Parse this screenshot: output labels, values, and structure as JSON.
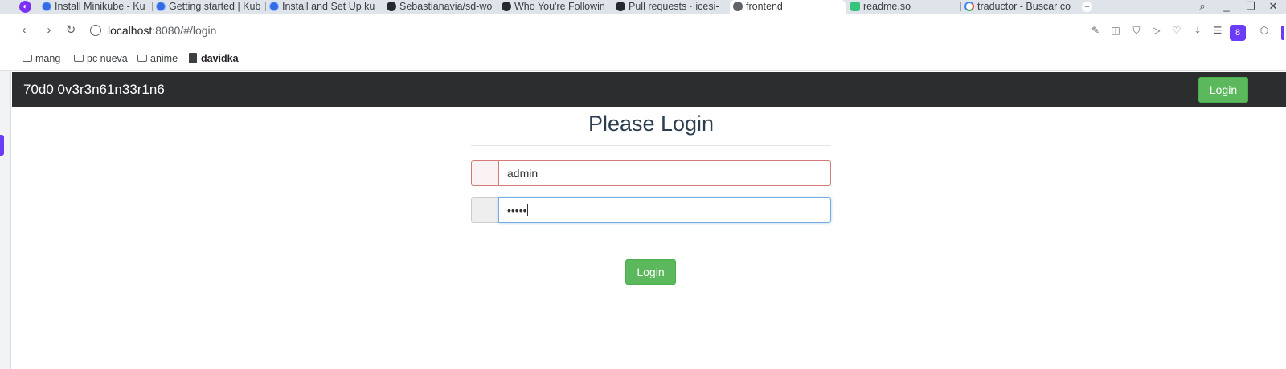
{
  "browser": {
    "tabs": [
      {
        "label": "Install Minikube - Ku",
        "favicon": "kubernetes-icon"
      },
      {
        "label": "Getting started | Kub",
        "favicon": "kubernetes-icon"
      },
      {
        "label": "Install and Set Up ku",
        "favicon": "kubernetes-icon"
      },
      {
        "label": "Sebastianavia/sd-wo",
        "favicon": "github-icon"
      },
      {
        "label": "Who You're Followin",
        "favicon": "github-icon"
      },
      {
        "label": "Pull requests · icesi-",
        "favicon": "github-icon"
      },
      {
        "label": "frontend",
        "favicon": "globe-icon",
        "active": true
      },
      {
        "label": "readme.so",
        "favicon": "readme-icon"
      },
      {
        "label": "traductor - Buscar co",
        "favicon": "google-icon"
      }
    ],
    "new_tab_symbol": "+",
    "url_host": "localhost",
    "url_rest": ":8080/#/login",
    "bookmarks": [
      {
        "label": "mang-",
        "icon": "folder-icon"
      },
      {
        "label": "pc nueva",
        "icon": "folder-icon"
      },
      {
        "label": "anime",
        "icon": "folder-icon"
      },
      {
        "label": "davidka",
        "icon": "file-icon"
      }
    ]
  },
  "app": {
    "brand": "70d0 0v3r3n61n33r1n6",
    "nav_login": "Login",
    "form": {
      "title": "Please Login",
      "username_value": "admin",
      "password_masked": "•••••",
      "submit_label": "Login"
    }
  },
  "colors": {
    "navbar_bg": "#2b2d2f",
    "success_green": "#5cb85c",
    "error_border": "#d47a78",
    "focus_border": "#74aee5",
    "title_color": "#2c3e50",
    "browser_accent": "#6b3cf6"
  }
}
